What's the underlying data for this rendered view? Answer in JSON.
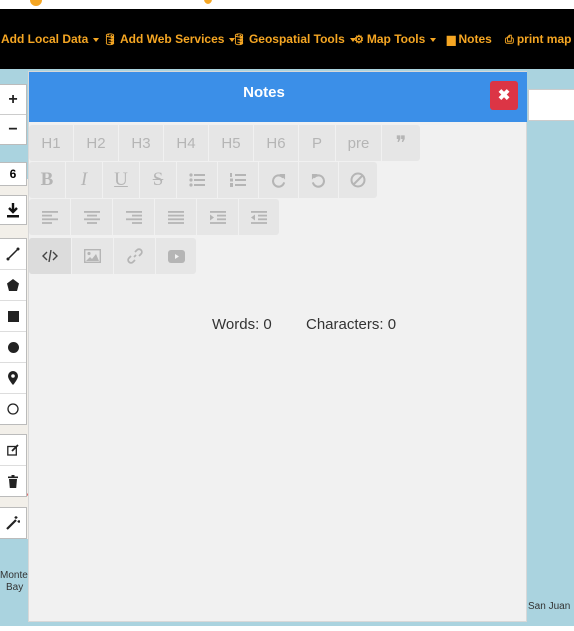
{
  "navbar": {
    "items": [
      {
        "label": "Add Local Data",
        "icon": "",
        "caret": true
      },
      {
        "label": "Add Web Services",
        "icon": "database-icon",
        "caret": true
      },
      {
        "label": "Geospatial Tools",
        "icon": "database-icon",
        "caret": true
      },
      {
        "label": "Map Tools",
        "icon": "cogs-icon",
        "caret": true
      },
      {
        "label": "Notes",
        "icon": "sticky-note-icon",
        "caret": false
      },
      {
        "label": "print map",
        "icon": "print-icon",
        "caret": false
      }
    ]
  },
  "map_controls": {
    "zoom_in": "+",
    "zoom_out": "−",
    "zoom_level": "6"
  },
  "map_labels": {
    "city_left_1": "Monteg",
    "city_left_2": "Bay",
    "city_right": "San Juan"
  },
  "notes_dialog": {
    "title": "Notes",
    "close": "✖",
    "headings": [
      "H1",
      "H2",
      "H3",
      "H4",
      "H5",
      "H6",
      "P",
      "pre",
      "❞"
    ],
    "text_tools": [
      "B",
      "I",
      "U",
      "S"
    ],
    "words_label": "Words: 0",
    "characters_label": "Characters: 0"
  },
  "colors": {
    "accent": "#f5a623",
    "header": "#3b8fe8",
    "close": "#dc3545"
  }
}
